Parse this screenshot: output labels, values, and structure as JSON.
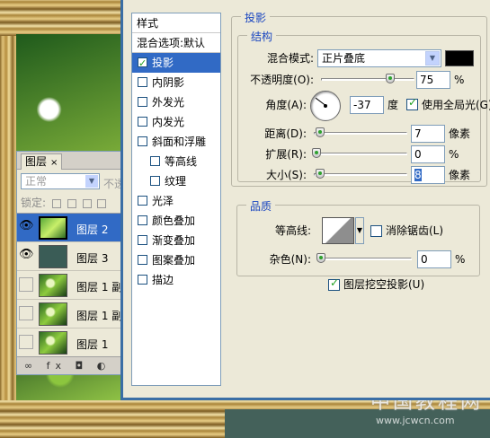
{
  "watermark": {
    "cn": "中国教程网",
    "url": "www.jcwcn.com"
  },
  "layers_panel": {
    "tab_label": "图层",
    "tab_close": "×",
    "blend_mode": "正常",
    "opacity_label": "不透",
    "lock_label": "锁定:",
    "footer_icons": "∞ fx ◘ ◐",
    "layers": [
      {
        "name": "图层 2",
        "visible": true,
        "selected": true,
        "thumb": "picture"
      },
      {
        "name": "图层 3",
        "visible": true,
        "selected": false,
        "thumb": "solid"
      },
      {
        "name": "图层 1 副",
        "visible": false,
        "selected": false,
        "thumb": "picture"
      },
      {
        "name": "图层 1 副",
        "visible": false,
        "selected": false,
        "thumb": "picture"
      },
      {
        "name": "图层 1",
        "visible": false,
        "selected": false,
        "thumb": "picture"
      }
    ]
  },
  "style_list": {
    "header": "样式",
    "blend_options": "混合选项:默认",
    "items": [
      {
        "label": "投影",
        "checked": true,
        "selected": true,
        "indent": false
      },
      {
        "label": "内阴影",
        "checked": false,
        "selected": false,
        "indent": false
      },
      {
        "label": "外发光",
        "checked": false,
        "selected": false,
        "indent": false
      },
      {
        "label": "内发光",
        "checked": false,
        "selected": false,
        "indent": false
      },
      {
        "label": "斜面和浮雕",
        "checked": false,
        "selected": false,
        "indent": false
      },
      {
        "label": "等高线",
        "checked": false,
        "selected": false,
        "indent": true
      },
      {
        "label": "纹理",
        "checked": false,
        "selected": false,
        "indent": true
      },
      {
        "label": "光泽",
        "checked": false,
        "selected": false,
        "indent": false
      },
      {
        "label": "颜色叠加",
        "checked": false,
        "selected": false,
        "indent": false
      },
      {
        "label": "渐变叠加",
        "checked": false,
        "selected": false,
        "indent": false
      },
      {
        "label": "图案叠加",
        "checked": false,
        "selected": false,
        "indent": false
      },
      {
        "label": "描边",
        "checked": false,
        "selected": false,
        "indent": false
      }
    ]
  },
  "drop_shadow": {
    "section_title": "投影",
    "structure": {
      "title": "结构",
      "blend_mode_label": "混合模式:",
      "blend_mode_value": "正片叠底",
      "shadow_color": "#000000",
      "opacity_label": "不透明度(O):",
      "opacity_value": "75",
      "opacity_unit": "%",
      "opacity_fraction": 0.75,
      "angle_label": "角度(A):",
      "angle_value": "-37",
      "angle_unit": "度",
      "global_light_label": "使用全局光(G)",
      "global_light_checked": true,
      "distance_label": "距离(D):",
      "distance_value": "7",
      "distance_unit": "像素",
      "spread_label": "扩展(R):",
      "spread_value": "0",
      "spread_unit": "%",
      "size_label": "大小(S):",
      "size_value": "8",
      "size_unit": "像素"
    },
    "quality": {
      "title": "品质",
      "contour_label": "等高线:",
      "anti_alias_label": "消除锯齿(L)",
      "anti_alias_checked": false,
      "noise_label": "杂色(N):",
      "noise_value": "0",
      "noise_unit": "%"
    },
    "knockout_label": "图层挖空投影(U)",
    "knockout_checked": true
  }
}
